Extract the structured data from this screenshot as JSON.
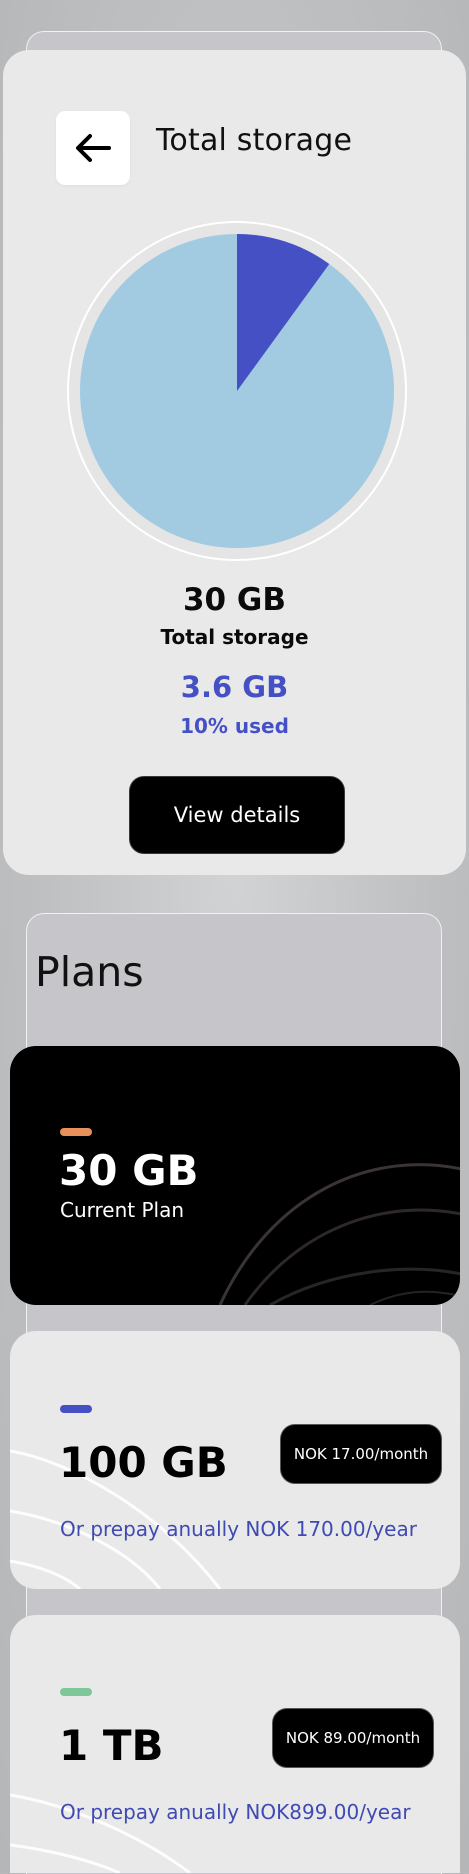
{
  "header": {
    "title": "Total storage"
  },
  "storage": {
    "total": "30 GB",
    "total_label": "Total storage",
    "used": "3.6 GB",
    "used_percent_label": "10% used",
    "used_fraction": 0.1,
    "view_details": "View details"
  },
  "plans": {
    "heading": "Plans",
    "current": {
      "size": "30 GB",
      "label": "Current Plan"
    },
    "items": [
      {
        "size": "100 GB",
        "price": "NOK 17.00/month",
        "prepay": "Or prepay anually NOK 170.00/year"
      },
      {
        "size": "1 TB",
        "price": "NOK 89.00/month",
        "prepay": "Or prepay anually NOK899.00/year"
      }
    ]
  },
  "colors": {
    "used": "#4550c5",
    "free": "#a2cbe2",
    "accent_current": "#e8915a",
    "accent_100gb": "#4550c5",
    "accent_1tb": "#7fc79a"
  }
}
